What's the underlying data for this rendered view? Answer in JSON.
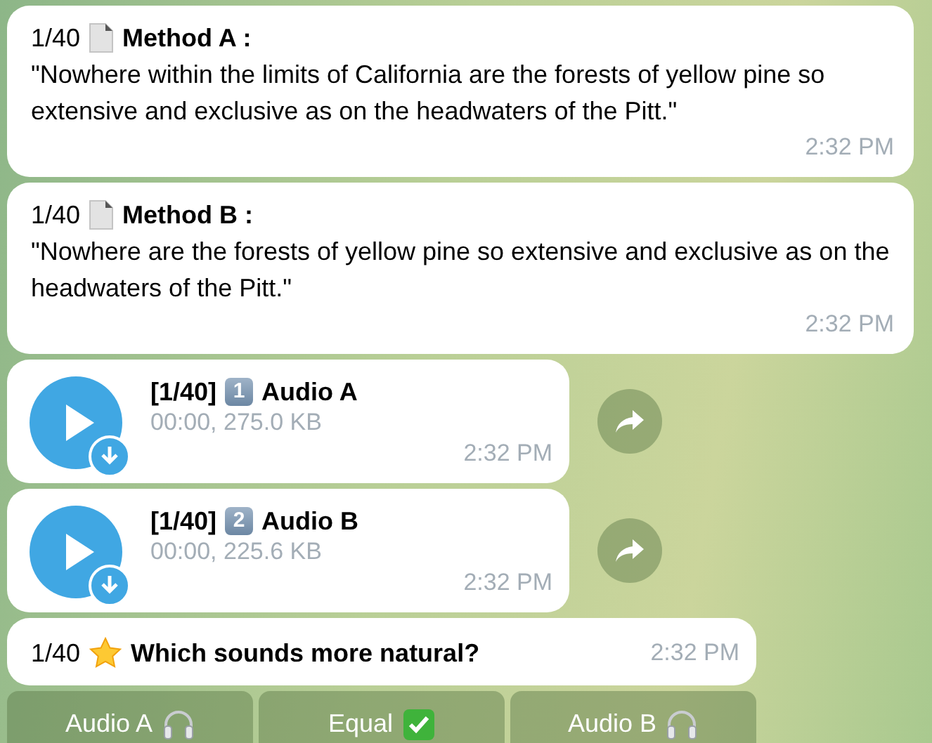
{
  "messages": [
    {
      "kind": "text",
      "counter": "1/40",
      "title": "Method A :",
      "body": "\"Nowhere within the limits of California are the forests of yellow pine so extensive and exclusive as on the headwaters of the Pitt.\"",
      "time": "2:32 PM"
    },
    {
      "kind": "text",
      "counter": "1/40",
      "title": "Method B :",
      "body": "\"Nowhere are the forests of yellow pine so extensive and exclusive as on the headwaters of the Pitt.\"",
      "time": "2:32 PM"
    },
    {
      "kind": "audio",
      "counter": "[1/40]",
      "keycap": "1",
      "title": "Audio A",
      "meta": "00:00, 275.0 KB",
      "time": "2:32 PM"
    },
    {
      "kind": "audio",
      "counter": "[1/40]",
      "keycap": "2",
      "title": "Audio B",
      "meta": "00:00, 225.6 KB",
      "time": "2:32 PM"
    },
    {
      "kind": "question",
      "counter": "1/40",
      "title": "Which sounds more natural?",
      "time": "2:32 PM"
    }
  ],
  "buttons": [
    {
      "label": "Audio A",
      "kind": "headphones"
    },
    {
      "label": "Equal",
      "kind": "check"
    },
    {
      "label": "Audio B",
      "kind": "headphones"
    }
  ]
}
